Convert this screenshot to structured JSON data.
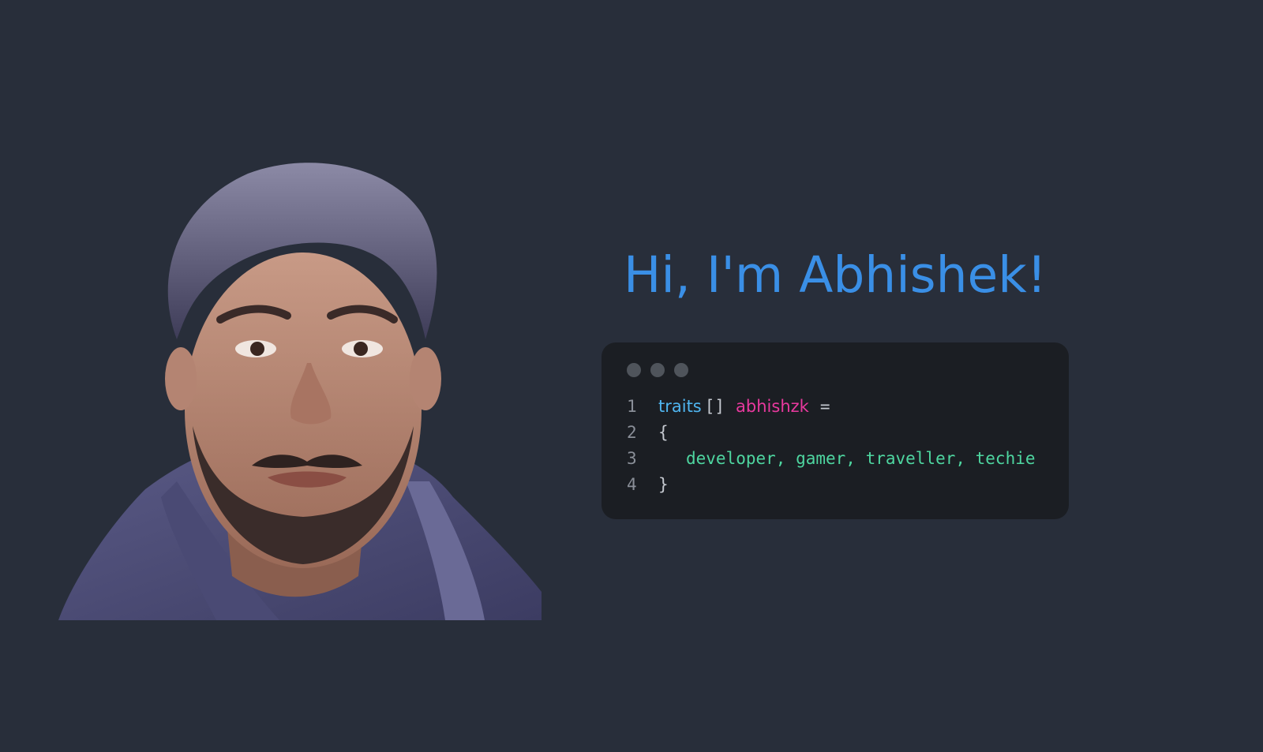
{
  "hero": {
    "greeting": "Hi, I'm Abhishek!"
  },
  "portrait": {
    "icon": "avatar-portrait"
  },
  "code_window": {
    "window_dots": [
      "dot",
      "dot",
      "dot"
    ],
    "lines": [
      {
        "number": "1",
        "type": "traits",
        "brackets": "[]",
        "name": "abhishzk",
        "op": "="
      },
      {
        "number": "2",
        "text": "{"
      },
      {
        "number": "3",
        "values": "developer, gamer, traveller, techie"
      },
      {
        "number": "4",
        "text": "}"
      }
    ]
  },
  "colors": {
    "background": "#282e3a",
    "heading": "#3a8fe6",
    "code_background": "#1b1e23",
    "type": "#4fb5f0",
    "identifier": "#e8399e",
    "values": "#4ed6a0"
  }
}
